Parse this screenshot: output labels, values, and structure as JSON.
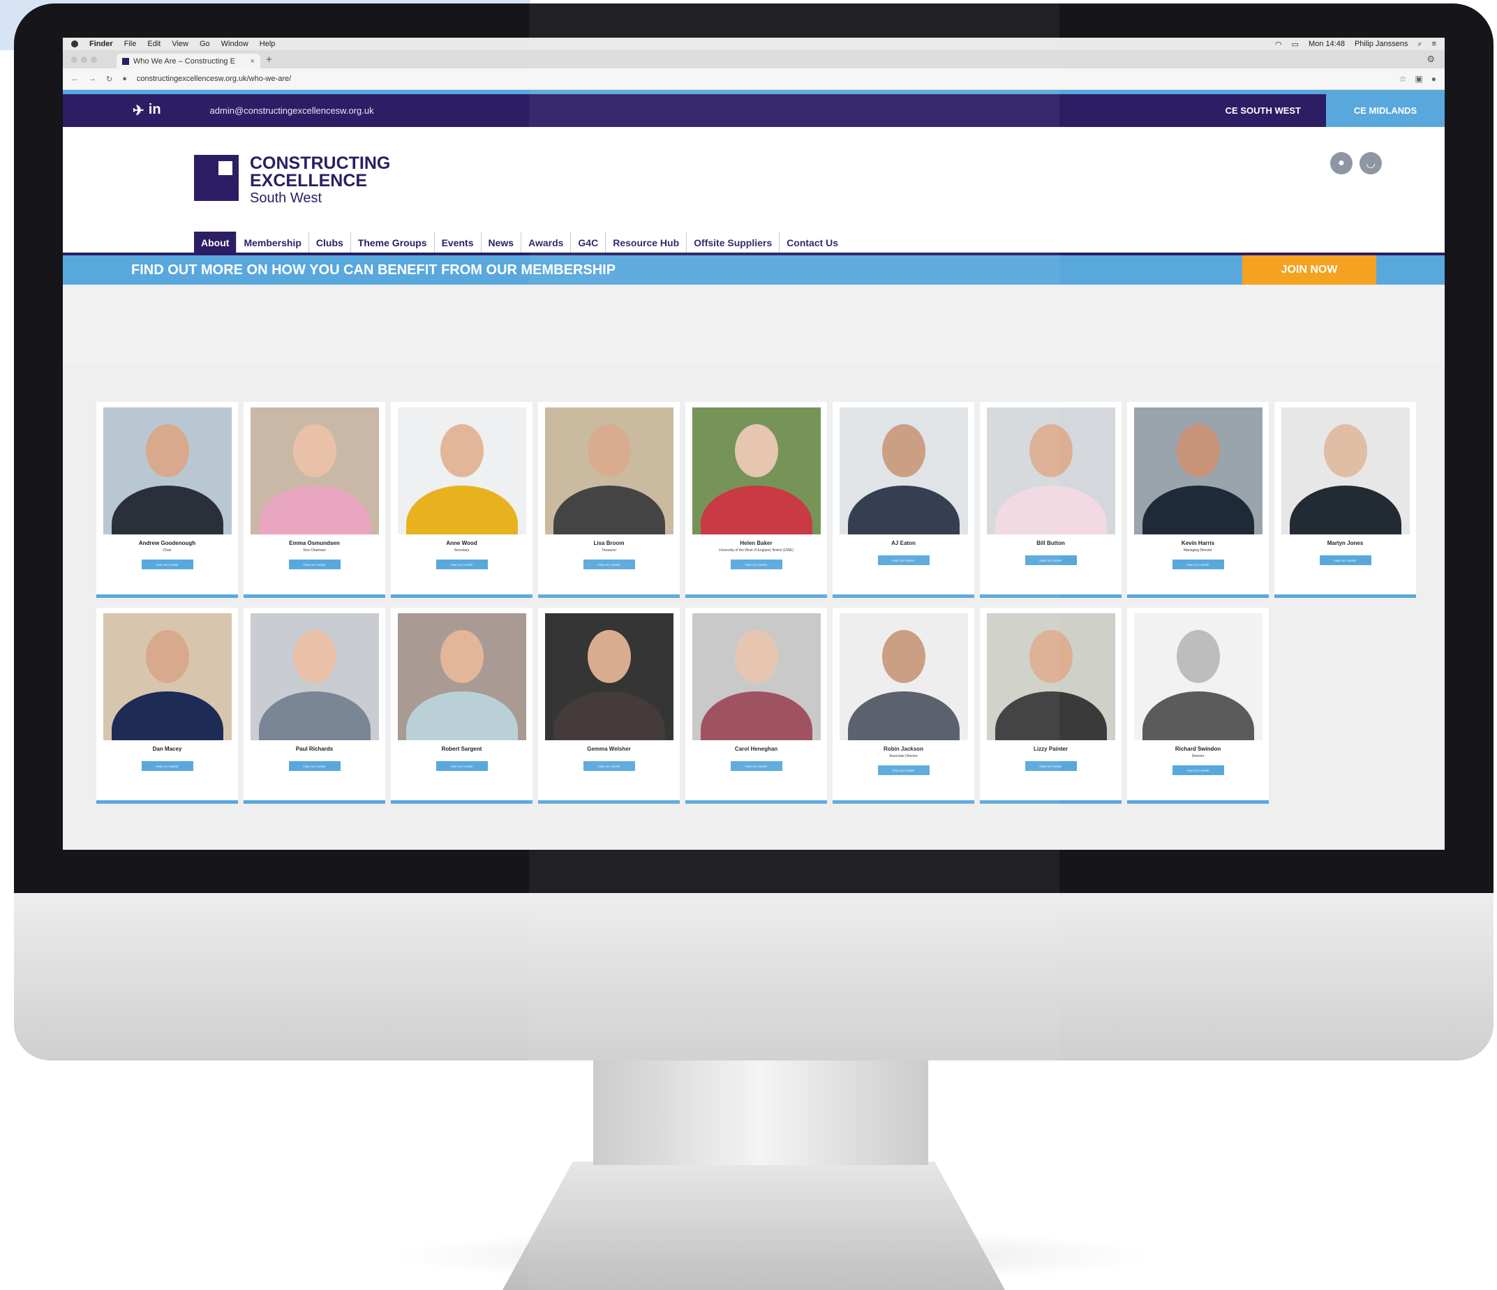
{
  "mac_menu": {
    "items": [
      "Finder",
      "File",
      "Edit",
      "View",
      "Go",
      "Window",
      "Help"
    ],
    "clock": "Mon 14:48",
    "user": "Philip Janssens"
  },
  "browser": {
    "tab_title": "Who We Are – Constructing E",
    "url": "constructingexcellencesw.org.uk/who-we-are/"
  },
  "topbar": {
    "email": "admin@constructingexcellencesw.org.uk",
    "ce_south_west": "CE SOUTH WEST",
    "ce_midlands": "CE MIDLANDS"
  },
  "logo": {
    "line1": "CONSTRUCTING",
    "line2": "EXCELLENCE",
    "line3": "South West"
  },
  "nav": [
    "About",
    "Membership",
    "Clubs",
    "Theme Groups",
    "Events",
    "News",
    "Awards",
    "G4C",
    "Resource Hub",
    "Offsite Suppliers",
    "Contact Us"
  ],
  "banner": {
    "text": "FIND OUT MORE ON HOW YOU CAN BENEFIT FROM OUR MEMBERSHIP",
    "cta": "JOIN NOW"
  },
  "find_out_more": "FIND OUT MORE",
  "people": [
    {
      "name": "Andrew Goodenough",
      "role": "Chair"
    },
    {
      "name": "Emma Osmundsen",
      "role": "Vice Chairman"
    },
    {
      "name": "Anne Wood",
      "role": "Secretary"
    },
    {
      "name": "Lisa Broom",
      "role": "Treasurer"
    },
    {
      "name": "Helen Baker",
      "role": "University of the West of England, Bristol (UWE)"
    },
    {
      "name": "AJ Eaton",
      "role": ""
    },
    {
      "name": "Bill Button",
      "role": ""
    },
    {
      "name": "Kevin Harris",
      "role": "Managing Director"
    },
    {
      "name": "Martyn Jones",
      "role": ""
    },
    {
      "name": "Dan Macey",
      "role": ""
    },
    {
      "name": "Paul Richards",
      "role": ""
    },
    {
      "name": "Robert Sargent",
      "role": ""
    },
    {
      "name": "Gemma Welsher",
      "role": ""
    },
    {
      "name": "Carol Heneghan",
      "role": ""
    },
    {
      "name": "Robin Jackson",
      "role": "Associate Director"
    },
    {
      "name": "Lizzy Painter",
      "role": ""
    },
    {
      "name": "Richard Swindon",
      "role": "Director"
    }
  ],
  "colors": {
    "purple": "#2c1d64",
    "blue": "#59a8dd",
    "orange": "#f4a21f"
  }
}
